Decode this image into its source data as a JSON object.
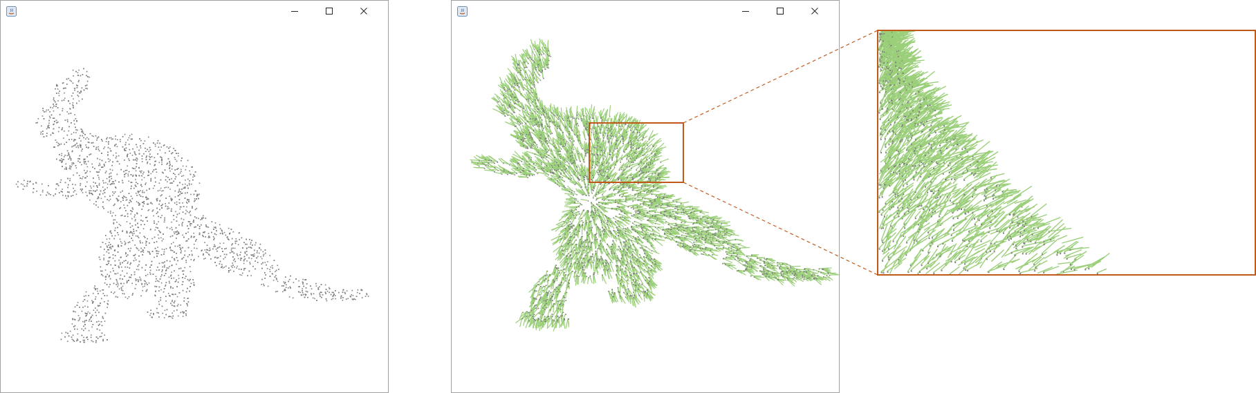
{
  "windows": [
    {
      "id": "left",
      "controls": [
        "minimize-icon",
        "maximize-icon",
        "close-icon"
      ],
      "content": "dinosaur-point-cloud"
    },
    {
      "id": "right",
      "controls": [
        "minimize-icon",
        "maximize-icon",
        "close-icon"
      ],
      "content": "dinosaur-point-cloud-with-normals"
    }
  ],
  "colors": {
    "points": "#7f7f7f",
    "normals": "#9bcf7a",
    "highlight": "#c0581a",
    "window_border": "#a0a0a0"
  }
}
